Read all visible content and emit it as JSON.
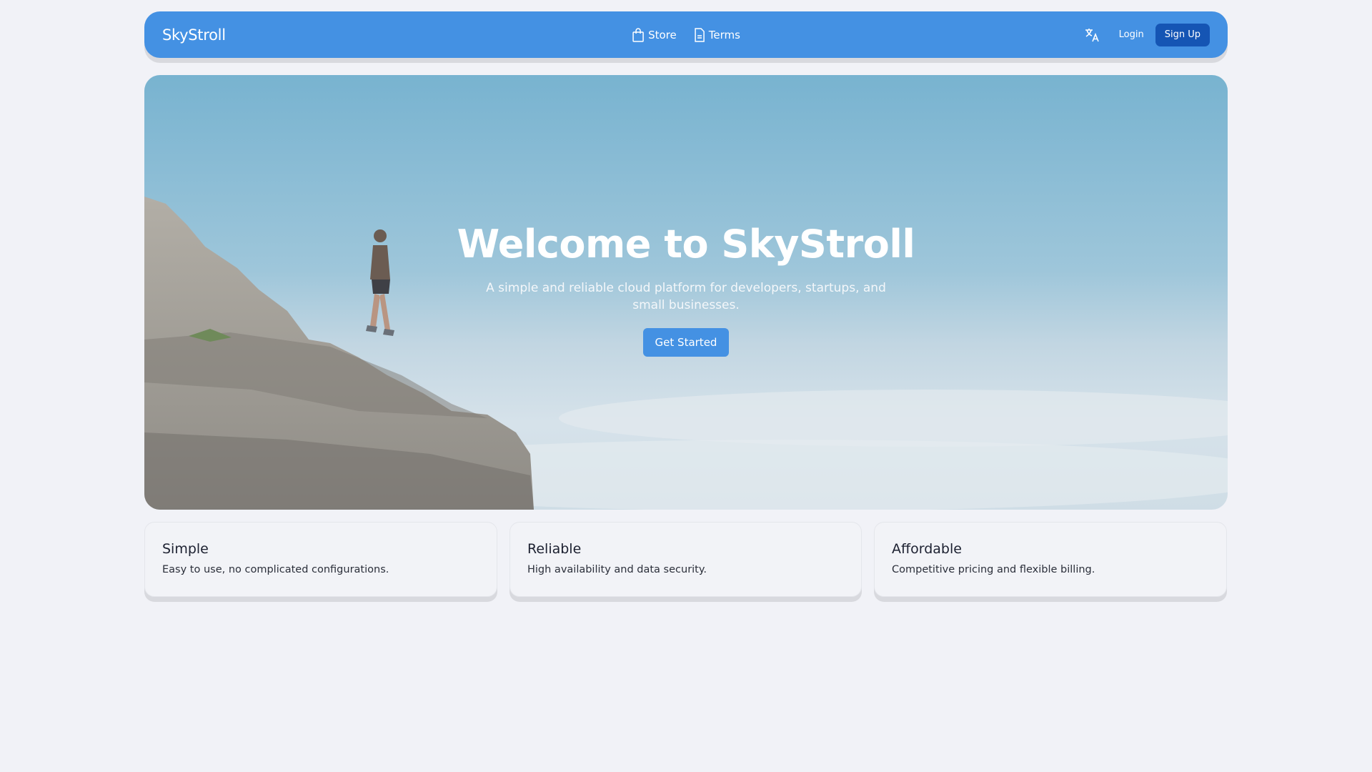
{
  "nav": {
    "brand": "SkyStroll",
    "links": [
      {
        "label": "Store",
        "icon": "shopping-bag-icon"
      },
      {
        "label": "Terms",
        "icon": "document-icon"
      }
    ],
    "language_icon": "translate-icon",
    "login": "Login",
    "signup": "Sign Up"
  },
  "hero": {
    "title": "Welcome to SkyStroll",
    "subtitle": "A simple and reliable cloud platform for developers, startups, and small businesses.",
    "cta": "Get Started"
  },
  "features": [
    {
      "title": "Simple",
      "text": "Easy to use, no complicated configurations."
    },
    {
      "title": "Reliable",
      "text": "High availability and data security."
    },
    {
      "title": "Affordable",
      "text": "Competitive pricing and flexible billing."
    }
  ],
  "colors": {
    "primary": "#4491e3",
    "signup": "#1555b4",
    "background": "#f1f2f7"
  }
}
